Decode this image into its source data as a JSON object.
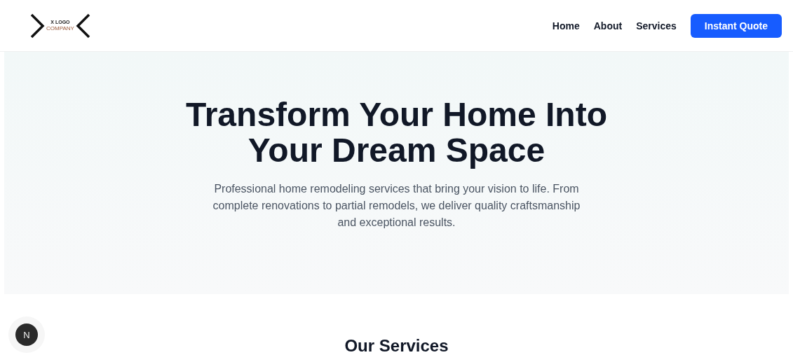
{
  "logo": {
    "title": "X LOGO",
    "subtitle": "COMPANY"
  },
  "nav": [
    {
      "label": "Home"
    },
    {
      "label": "About"
    },
    {
      "label": "Services"
    }
  ],
  "cta": "Instant Quote",
  "hero": {
    "title_lines": [
      "Transform Your Home Into",
      "Your Dream Space"
    ],
    "text": "Professional home remodeling services that bring your vision to life. From complete renovations to partial remodels, we deliver quality craftsmanship and exceptional results."
  },
  "dev_badge": "N",
  "section_title": "Our Services"
}
